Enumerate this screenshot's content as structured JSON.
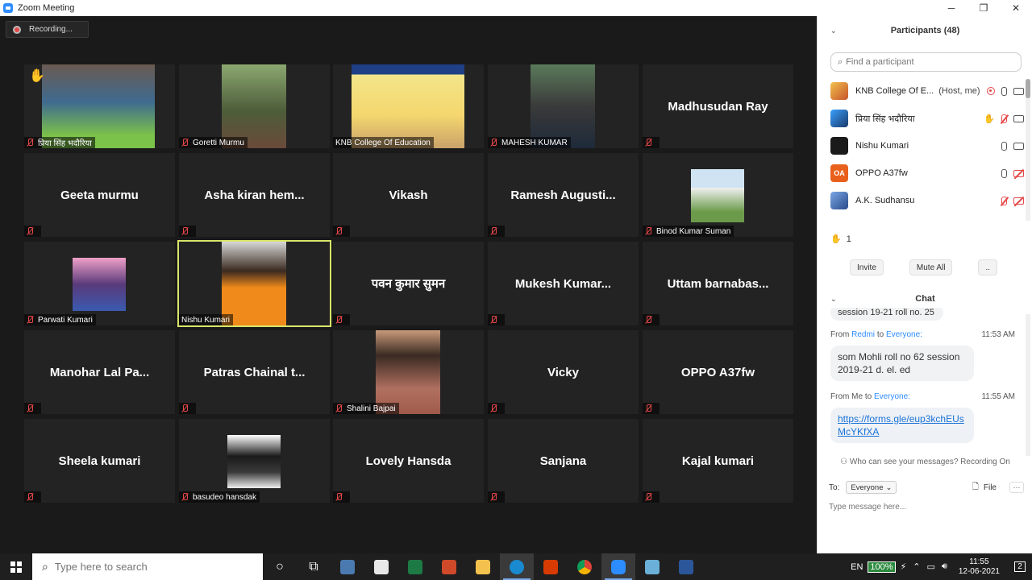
{
  "window": {
    "title": "Zoom Meeting",
    "minimize": "─",
    "maximize": "❐",
    "close": "✕"
  },
  "recording": {
    "label": "Recording..."
  },
  "tiles": {
    "t1": {
      "name": "प्रिया सिंह भदौरिया"
    },
    "t2": {
      "name": "Goretti Murmu"
    },
    "t3": {
      "name": "KNB College Of Education"
    },
    "t4": {
      "name": "MAHESH KUMAR"
    },
    "t5": {
      "big": "Madhusudan Ray"
    },
    "t6": {
      "big": "Geeta murmu"
    },
    "t7": {
      "big": "Asha kiran hem..."
    },
    "t8": {
      "big": "Vikash"
    },
    "t9": {
      "big": "Ramesh Augusti..."
    },
    "t10": {
      "name": "Binod Kumar Suman"
    },
    "t11": {
      "name": "Parwati Kumari"
    },
    "t12": {
      "name": "Nishu Kumari"
    },
    "t13": {
      "big": "पवन कुमार सुमन"
    },
    "t14": {
      "big": "Mukesh Kumar..."
    },
    "t15": {
      "big": "Uttam barnabas..."
    },
    "t16": {
      "big": "Manohar Lal Pa..."
    },
    "t17": {
      "big": "Patras Chainal t..."
    },
    "t18": {
      "name": "Shalini Bajpai"
    },
    "t19": {
      "big": "Vicky"
    },
    "t20": {
      "big": "OPPO A37fw"
    },
    "t21": {
      "big": "Sheela kumari"
    },
    "t22": {
      "name": "basudeo hansdak"
    },
    "t23": {
      "big": "Lovely Hansda"
    },
    "t24": {
      "big": "Sanjana"
    },
    "t25": {
      "big": "Kajal kumari"
    }
  },
  "participants": {
    "title": "Participants (48)",
    "search_placeholder": "Find a participant",
    "list": [
      {
        "name": "KNB College Of E...",
        "status": "(Host, me)",
        "initials": ""
      },
      {
        "name": "प्रिया सिंह भदौरिया",
        "status": "",
        "initials": ""
      },
      {
        "name": "Nishu Kumari",
        "status": "",
        "initials": ""
      },
      {
        "name": "OPPO A37fw",
        "status": "",
        "initials": "OA"
      },
      {
        "name": "A.K. Sudhansu",
        "status": "",
        "initials": ""
      }
    ],
    "raised_hands": "1",
    "invite": "Invite",
    "mute_all": "Mute All",
    "more": ".."
  },
  "chat": {
    "title": "Chat",
    "messages": [
      {
        "from_prefix": "From",
        "from": "Redmi",
        "to_prefix": "to",
        "to": "Everyone:",
        "time": "11:53 AM",
        "text": "som Mohli roll no 62 session 2019-21 d. el. ed"
      },
      {
        "from_prefix": "From",
        "from": "Me",
        "to_prefix": "to",
        "to": "Everyone:",
        "time": "11:55 AM",
        "text": "https://forms.gle/eup3kchEUsMcYKfXA"
      }
    ],
    "previous_snippet": "session 19-21 roll no. 25",
    "who_can_see": "Who can see your messages? Recording On",
    "to_label": "To:",
    "to_value": "Everyone",
    "file_label": "File",
    "more": "···",
    "input_placeholder": "Type message here..."
  },
  "taskbar": {
    "search_placeholder": "Type here to search",
    "lang": "EN",
    "battery": "100%",
    "time": "11:55",
    "date": "12-06-2021",
    "notifications": "2"
  }
}
